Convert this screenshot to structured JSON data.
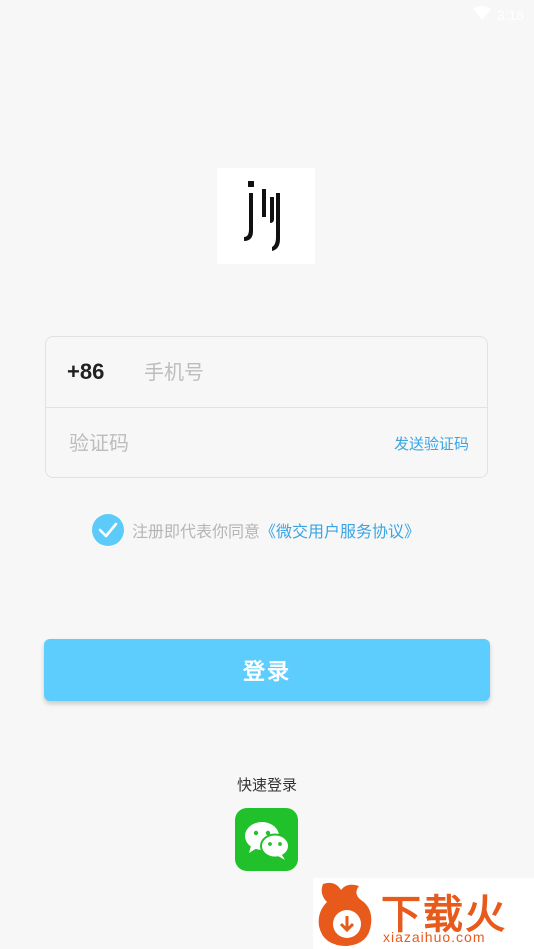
{
  "status_bar": {
    "time": "3:18",
    "wifi_icon": "wifi-icon",
    "battery_icon": "battery-icon"
  },
  "logo": {
    "icon": "app-logo-jy"
  },
  "form": {
    "country_code": "+86",
    "phone_placeholder": "手机号",
    "code_placeholder": "验证码",
    "send_code_label": "发送验证码"
  },
  "agreement": {
    "checked": true,
    "prefix": "注册即代表你同意",
    "link_text": "《微交用户服务协议》"
  },
  "login_button": {
    "label": "登录"
  },
  "quick_login": {
    "label": "快速登录",
    "icon": "wechat-icon"
  },
  "watermark": {
    "cn": "下载火",
    "en": "xiazaihuo.com"
  },
  "colors": {
    "accent": "#5dcdfd",
    "link": "#3aa4e4",
    "wechat": "#21c12c",
    "watermark": "#e85a1c"
  }
}
